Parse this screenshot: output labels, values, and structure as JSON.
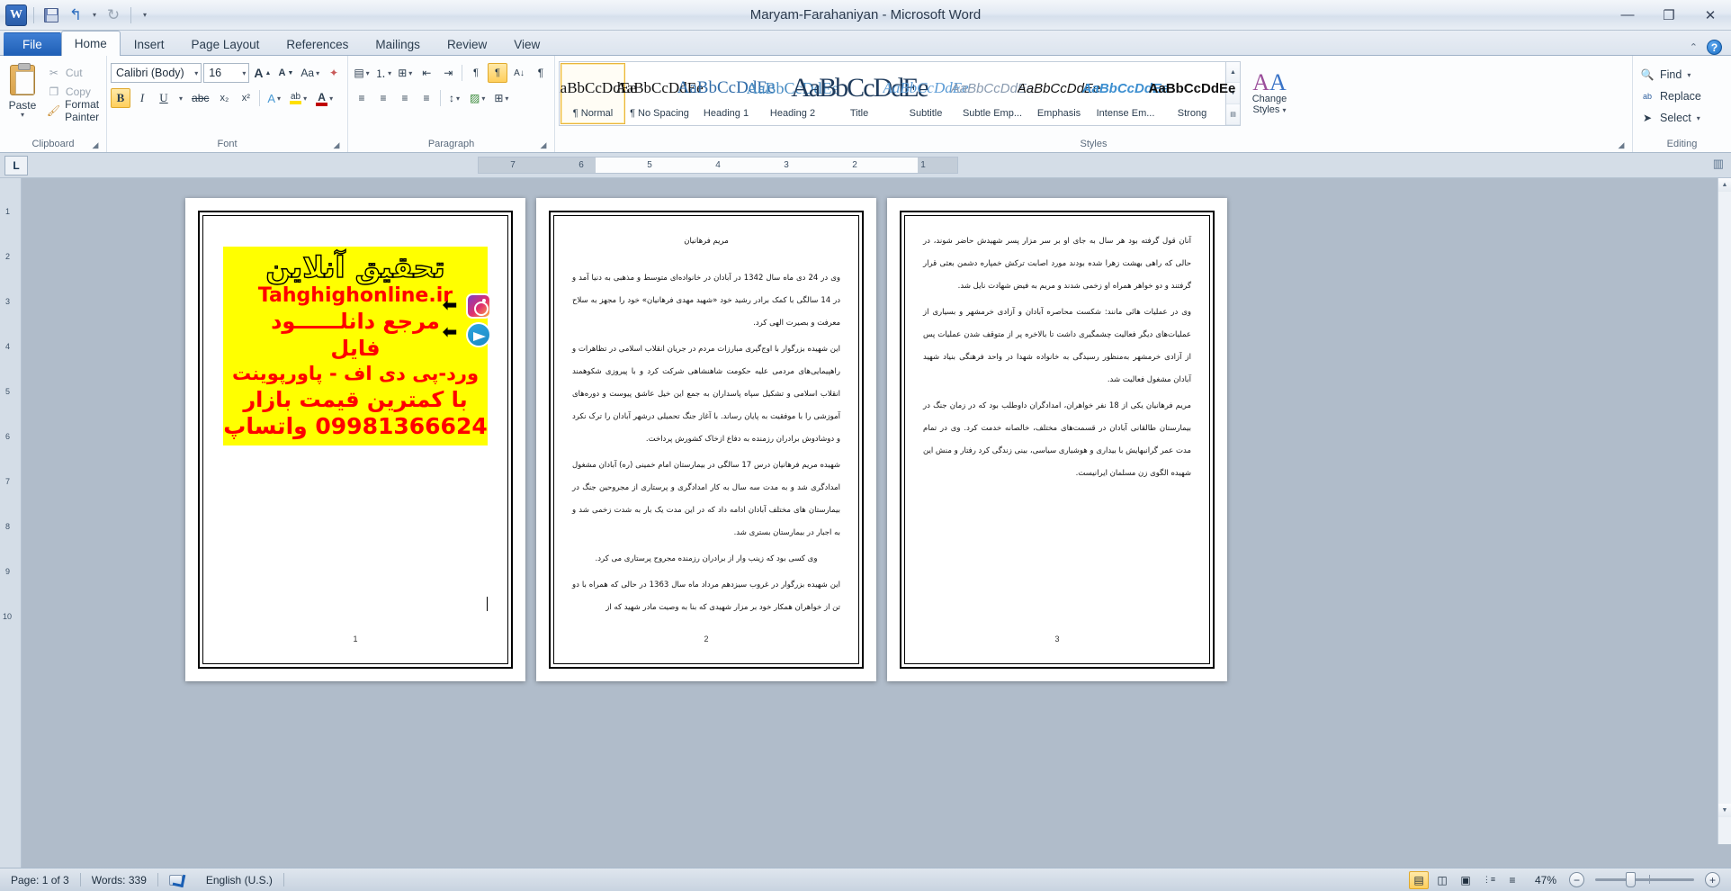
{
  "titlebar": {
    "app_icon": "word-logo",
    "document_title": "Maryam-Farahaniyan  -  Microsoft Word",
    "qat": [
      {
        "name": "save",
        "icon": "save-icon"
      },
      {
        "name": "undo",
        "icon": "undo-icon",
        "glyph": "↰"
      },
      {
        "name": "redo",
        "icon": "redo-icon",
        "glyph": "↻"
      },
      {
        "name": "customize",
        "icon": "chevron-down-icon",
        "glyph": "▾"
      }
    ],
    "window_controls": {
      "minimize": "—",
      "restore": "❐",
      "close": "✕"
    }
  },
  "tabs": [
    {
      "label": "File",
      "active": false,
      "file": true
    },
    {
      "label": "Home",
      "active": true
    },
    {
      "label": "Insert",
      "active": false
    },
    {
      "label": "Page Layout",
      "active": false
    },
    {
      "label": "References",
      "active": false
    },
    {
      "label": "Mailings",
      "active": false
    },
    {
      "label": "Review",
      "active": false
    },
    {
      "label": "View",
      "active": false
    }
  ],
  "tab_right": {
    "minimize_ribbon": "⌃",
    "help": "?"
  },
  "ribbon": {
    "clipboard": {
      "label": "Clipboard",
      "paste": "Paste",
      "paste_caret": "▾",
      "commands": [
        {
          "label": "Cut",
          "icon": "scissors-icon",
          "glyph": "✂",
          "enabled": false
        },
        {
          "label": "Copy",
          "icon": "copy-icon",
          "glyph": "❐",
          "enabled": false
        },
        {
          "label": "Format Painter",
          "icon": "paintbrush-icon",
          "glyph": "🖌",
          "enabled": true
        }
      ]
    },
    "font": {
      "label": "Font",
      "font_name": "Calibri (Body)",
      "font_size": "16",
      "caret": "▾",
      "grow_font": "A",
      "shrink_font": "A",
      "change_case": "Aa",
      "clear_formatting": "✦",
      "bold": "B",
      "italic": "I",
      "underline": "U",
      "strikethrough": "abc",
      "subscript": "x₂",
      "superscript": "x²",
      "text_effects": "A",
      "highlight": "ab",
      "font_color": "A"
    },
    "paragraph": {
      "label": "Paragraph",
      "bullets": "▤",
      "numbering": "⒈",
      "multilevel": "⊞",
      "decrease_indent": "⇤",
      "increase_indent": "⇥",
      "ltr": "¶",
      "rtl": "¶",
      "sort": "A↓",
      "show_marks": "¶",
      "align_left": "≡",
      "align_center": "≡",
      "align_right": "≡",
      "justify": "≡",
      "line_spacing": "↕",
      "shading": "▨",
      "borders": "⊞"
    },
    "styles": {
      "label": "Styles",
      "items": [
        {
          "preview": "AaBbCcDdEe",
          "label": "¶ Normal",
          "selected": true,
          "style": "normal"
        },
        {
          "preview": "AaBbCcDdEe",
          "label": "¶ No Spacing",
          "selected": false,
          "style": "nospacing"
        },
        {
          "preview": "AaBbCcDdEe",
          "label": "Heading 1",
          "selected": false,
          "style": "h1"
        },
        {
          "preview": "AaBbCcDdEe",
          "label": "Heading 2",
          "selected": false,
          "style": "h2"
        },
        {
          "preview": "AaBbCcDdEe",
          "label": "Title",
          "selected": false,
          "style": "title"
        },
        {
          "preview": "AaBbCcDdEe",
          "label": "Subtitle",
          "selected": false,
          "style": "subtitle"
        },
        {
          "preview": "AaBbCcDdEe",
          "label": "Subtle Emp...",
          "selected": false,
          "style": "subtleemp"
        },
        {
          "preview": "AaBbCcDdEe",
          "label": "Emphasis",
          "selected": false,
          "style": "emphasis"
        },
        {
          "preview": "AaBbCcDdEe",
          "label": "Intense Em...",
          "selected": false,
          "style": "intense"
        },
        {
          "preview": "AaBbCcDdEe",
          "label": "Strong",
          "selected": false,
          "style": "strong"
        }
      ],
      "change_styles": "Change",
      "change_styles2": "Styles",
      "change_caret": "▾",
      "scroll_up": "▲",
      "scroll_down": "▼",
      "scroll_more": "▤"
    },
    "editing": {
      "label": "Editing",
      "find": "Find",
      "find_caret": "▾",
      "replace": "Replace",
      "select": "Select",
      "select_caret": "▾"
    }
  },
  "ruler": {
    "tab_selector": "L",
    "numbers": [
      "7",
      "6",
      "5",
      "4",
      "3",
      "2",
      "1"
    ],
    "vertical_numbers": [
      "1",
      "2",
      "3",
      "4",
      "5",
      "6",
      "7",
      "8",
      "9",
      "10"
    ]
  },
  "document": {
    "pages": [
      {
        "number": "1",
        "type": "ad",
        "ad": {
          "headline": "تحقیق آنلاین",
          "url": "Tahghighonline.ir",
          "line3": "مرجع دانلــــــود",
          "line4": "فایل",
          "line5": "ورد-پی دی اف - پاورپوینت",
          "line6": "با کمترین قیمت بازار",
          "line7": "09981366624 واتساپ",
          "icons": [
            "instagram-icon",
            "telegram-icon"
          ],
          "bg_color": "#ffff00",
          "text_color": "#ff0000"
        }
      },
      {
        "number": "2",
        "type": "text",
        "heading": "مریم فرهانیان",
        "paragraphs": [
          "وی در 24 دی ماه سال 1342 در آبادان در خانواده‌ای متوسط و مذهبی به دنیا آمد و در 14 سالگی با کمک برادر رشید خود «شهید مهدی فرهانیان» خود را مجهز به سلاح معرفت و بصیرت الهی کرد.",
          "این شهیده بزرگوار با اوج‌گیری مبارزات مردم در جریان انقلاب اسلامی در تظاهرات و راهپیمایی‌های مردمی علیه حکومت شاهنشاهی شرکت کرد و با پیروزی شکوهمند انقلاب اسلامی و تشکیل سپاه پاسداران به جمع این خیل عاشق پیوست و دوره‌های آموزشی را با موفقیت به پایان رساند. با آغاز جنگ تحمیلی درشهر آبادان را ترک نکرد و دوشادوش برادران رزمنده به دفاع ازخاک کشورش پرداخت.",
          "شهیده مریم فرهانیان درس 17 سالگی در بیمارستان امام خمینی (ره) آبادان مشغول امدادگری شد و به مدت سه سال به کار امدادگری و پرستاری از مجروحین جنگ در بیمارستان های مختلف آبادان ادامه داد که در این مدت یک بار به شدت زخمی شد و به اجبار در بیمارستان بستری شد.",
          "وی کسی بود که زینب وار از برادران رزمنده مجروح پرستاری می کرد.",
          "این شهیده بزرگوار در غروب سیزدهم مرداد ماه سال 1363 در حالی که همراه با دو تن از خواهران همکار خود بر مزار شهیدی که بنا به وصیت مادر شهید که از"
        ]
      },
      {
        "number": "3",
        "type": "text",
        "paragraphs": [
          "آنان قول گرفته بود هر سال به جای او بر سر مزار پسر شهیدش حاضر شوند، در حالی که راهی بهشت زهرا شده بودند مورد اصابت ترکش خمپاره دشمن بعثی قرار گرفتند و دو خواهر همراه او زخمی شدند و مریم به فیض شهادت نایل شد.",
          "وی در عملیات هائی مانند: شکست محاصره آبادان و آزادی خرمشهر و بسیاری از عملیات‌های دیگر فعالیت چشمگیری داشت تا بالاخره پر از متوقف شدن عملیات پس از آزادی خرمشهر به‌منظور رسیدگی به خانواده شهدا در واحد فرهنگی بنیاد شهید آبادان مشغول فعالیت شد.",
          "مریم فرهانیان یکی از 18 نفر خواهران، امدادگران داوطلب بود که در زمان جنگ در بیمارستان طالقانی آبادان در قسمت‌های مختلف، خالصانه خدمت کرد. وی در تمام مدت عمر گرانبهایش با بیداری و هوشیاری سیاسی، بینی زندگی کرد رفتار و منش این شهیده الگوی زن مسلمان ایرانیست."
        ]
      }
    ]
  },
  "statusbar": {
    "page_info": "Page: 1 of 3",
    "word_count": "Words: 339",
    "proofing_icon": "spelling-check-icon",
    "language": "English (U.S.)",
    "view_buttons": [
      {
        "name": "print-layout-view",
        "glyph": "▤",
        "active": true
      },
      {
        "name": "full-screen-reading-view",
        "glyph": "◫",
        "active": false
      },
      {
        "name": "web-layout-view",
        "glyph": "▣",
        "active": false
      },
      {
        "name": "outline-view",
        "glyph": "⋮≡",
        "active": false
      },
      {
        "name": "draft-view",
        "glyph": "≡",
        "active": false
      }
    ],
    "zoom_level": "47%",
    "zoom_out": "−",
    "zoom_in": "+"
  },
  "colors": {
    "accent": "#1f5fb5",
    "ad_background": "#ffff00",
    "ad_text": "#ff0000",
    "selection_highlight": "#e8b53d",
    "ribbon_bg": "#fcfdfe"
  }
}
